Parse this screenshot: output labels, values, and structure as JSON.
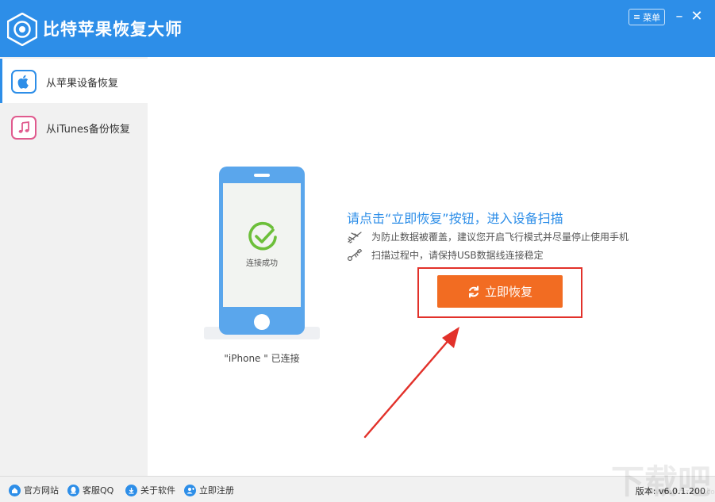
{
  "app": {
    "title": "比特苹果恢复大师",
    "menu_label": "菜单",
    "minimize_glyph": "–",
    "close_glyph": "✕"
  },
  "sidebar": {
    "items": [
      {
        "label": "从苹果设备恢复",
        "icon": "apple-icon",
        "active": true
      },
      {
        "label": "从iTunes备份恢复",
        "icon": "music-note-icon",
        "active": false
      }
    ]
  },
  "device": {
    "screen_text": "连接成功",
    "status_text": "\"iPhone \" 已连接"
  },
  "instructions": {
    "heading": "请点击“立即恢复”按钮，进入设备扫描",
    "tips": [
      {
        "icon": "airplane-icon",
        "text": "为防止数据被覆盖，建议您开启飞行模式并尽量停止使用手机"
      },
      {
        "icon": "usb-icon",
        "text": "扫描过程中，请保持USB数据线连接稳定"
      }
    ]
  },
  "recover_button": {
    "label": "立即恢复"
  },
  "statusbar": {
    "links": [
      {
        "label": "官方网站",
        "icon": "home-icon"
      },
      {
        "label": "客服QQ",
        "icon": "qq-icon"
      },
      {
        "label": "关于软件",
        "icon": "download-icon"
      },
      {
        "label": "立即注册",
        "icon": "user-add-icon"
      }
    ],
    "version": "版本: v6.0.1.200"
  },
  "watermark": {
    "text": "下载吧",
    "sub": "www.xiazaiba.com"
  },
  "colors": {
    "brand_blue": "#2d8ee8",
    "button_orange": "#f26c22",
    "highlight_red": "#e2312a",
    "success_green": "#6cbf3a"
  }
}
